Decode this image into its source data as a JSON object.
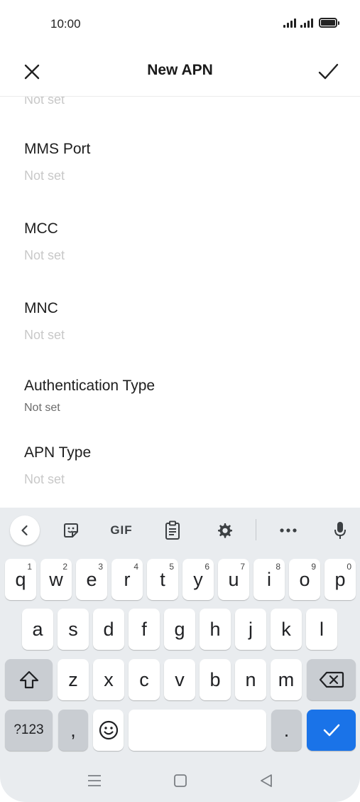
{
  "status_bar": {
    "time": "10:00"
  },
  "app_bar": {
    "title": "New APN"
  },
  "list": {
    "clipped_value": "Not set",
    "items": [
      {
        "title": "MMS Port",
        "value": "Not set"
      },
      {
        "title": "MCC",
        "value": "Not set"
      },
      {
        "title": "MNC",
        "value": "Not set"
      },
      {
        "title": "Authentication Type",
        "value": "Not set"
      },
      {
        "title": "APN Type",
        "value": "Not set"
      }
    ]
  },
  "keyboard": {
    "toolbar": {
      "gif_label": "GIF"
    },
    "row1": [
      {
        "key": "q",
        "hint": "1"
      },
      {
        "key": "w",
        "hint": "2"
      },
      {
        "key": "e",
        "hint": "3"
      },
      {
        "key": "r",
        "hint": "4"
      },
      {
        "key": "t",
        "hint": "5"
      },
      {
        "key": "y",
        "hint": "6"
      },
      {
        "key": "u",
        "hint": "7"
      },
      {
        "key": "i",
        "hint": "8"
      },
      {
        "key": "o",
        "hint": "9"
      },
      {
        "key": "p",
        "hint": "0"
      }
    ],
    "row2": [
      "a",
      "s",
      "d",
      "f",
      "g",
      "h",
      "j",
      "k",
      "l"
    ],
    "row3": [
      "z",
      "x",
      "c",
      "v",
      "b",
      "n",
      "m"
    ],
    "row4": {
      "symbols_label": "?123",
      "comma": ",",
      "period": "."
    }
  },
  "colors": {
    "accent": "#1a73e8",
    "keyboard_bg": "#e9ecef",
    "placeholder": "#c8c8c8"
  }
}
